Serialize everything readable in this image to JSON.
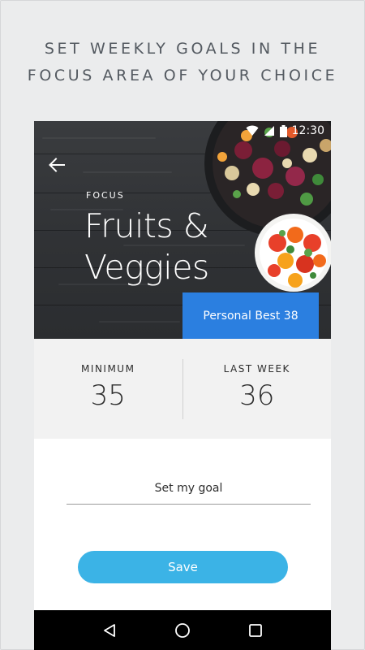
{
  "promo": {
    "headline_line1": "SET WEEKLY GOALS IN THE",
    "headline_line2": "FOCUS AREA OF YOUR CHOICE"
  },
  "status_bar": {
    "time": "12:30",
    "icons": [
      "wifi-icon",
      "signal-icon",
      "battery-icon"
    ]
  },
  "header": {
    "back_icon": "arrow-left-icon",
    "focus_label": "FOCUS",
    "title_line1": "Fruits &",
    "title_line2": "Veggies",
    "personal_best": "Personal Best 38"
  },
  "stats": {
    "minimum_label": "MINIMUM",
    "minimum_value": "35",
    "last_week_label": "LAST WEEK",
    "last_week_value": "36"
  },
  "goal": {
    "placeholder": "Set my goal"
  },
  "actions": {
    "save_label": "Save"
  },
  "navigation": {
    "icons": [
      "back-triangle-icon",
      "home-circle-icon",
      "recents-square-icon"
    ]
  },
  "colors": {
    "accent_blue": "#2b7fe0",
    "save_blue": "#3bb3e6",
    "background": "#ebeced",
    "headline_text": "#545a61"
  }
}
